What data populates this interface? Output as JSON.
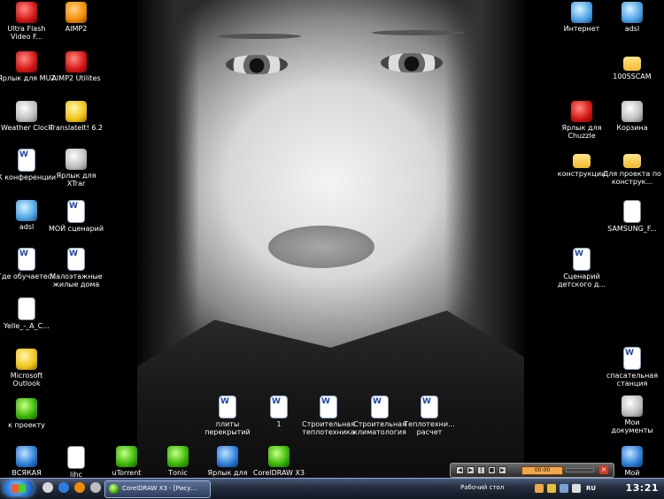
{
  "desktop_icons": [
    {
      "label": "Ultra Flash Video F...",
      "icon": "app-icon"
    },
    {
      "label": "AIMP2",
      "icon": "music-player-icon"
    },
    {
      "label": "Ярлык для MUZ",
      "icon": "shortcut-icon"
    },
    {
      "label": "AIMP2 Utilites",
      "icon": "tools-icon"
    },
    {
      "label": "Weather Clock",
      "icon": "clock-icon"
    },
    {
      "label": "TranslateIt! 6.2",
      "icon": "translate-icon"
    },
    {
      "label": "К конференции",
      "icon": "word-doc-icon"
    },
    {
      "label": "Ярлык для XTrar",
      "icon": "shortcut-icon"
    },
    {
      "label": "adsl",
      "icon": "network-icon"
    },
    {
      "label": "МОЙ сценарий",
      "icon": "word-doc-icon"
    },
    {
      "label": "Где обучаетесь",
      "icon": "word-doc-icon"
    },
    {
      "label": "Малоэтажные жилые дома",
      "icon": "word-doc-icon"
    },
    {
      "label": "Yelle_-_A_C...",
      "icon": "file-icon"
    },
    {
      "label": "Microsoft Outlook",
      "icon": "outlook-icon"
    },
    {
      "label": "к проекту",
      "icon": "folder-icon"
    },
    {
      "label": "ВСЯКАЯ",
      "icon": "folder-icon"
    },
    {
      "label": "lihc",
      "icon": "file-icon"
    },
    {
      "label": "uTorrent",
      "icon": "utorrent-icon"
    },
    {
      "label": "Тоnic",
      "icon": "app-icon"
    },
    {
      "label": "Ярлык для",
      "icon": "shortcut-icon"
    },
    {
      "label": "CorelDRAW X3",
      "icon": "coreldraw-icon"
    },
    {
      "label": "плиты перекрытий",
      "icon": "word-doc-icon"
    },
    {
      "label": "1",
      "icon": "word-doc-icon"
    },
    {
      "label": "Строительная теплотехника",
      "icon": "word-doc-icon"
    },
    {
      "label": "Строительная климатология",
      "icon": "word-doc-icon"
    },
    {
      "label": "Теплотехни... расчет",
      "icon": "word-doc-icon"
    },
    {
      "label": "Интернет",
      "icon": "internet-explorer-icon"
    },
    {
      "label": "adsl",
      "icon": "network-icon"
    },
    {
      "label": "100SSCAM",
      "icon": "folder-icon"
    },
    {
      "label": "Ярлык для Chuzzle",
      "icon": "shortcut-icon"
    },
    {
      "label": "Корзина",
      "icon": "recycle-bin-icon"
    },
    {
      "label": "конструкции",
      "icon": "folder-icon"
    },
    {
      "label": "Для проекта по конструк...",
      "icon": "folder-icon"
    },
    {
      "label": "SAMSUNG_F...",
      "icon": "file-icon"
    },
    {
      "label": "Сценарий детского д...",
      "icon": "word-doc-icon"
    },
    {
      "label": "спасательная станция",
      "icon": "word-doc-icon"
    },
    {
      "label": "Мои документы",
      "icon": "my-documents-icon"
    },
    {
      "label": "Мой",
      "icon": "my-computer-icon"
    }
  ],
  "media_player": {
    "time_display": "00:00",
    "buttons": [
      "prev",
      "play",
      "pause",
      "stop",
      "next"
    ]
  },
  "taskbar": {
    "active_window": "CorelDRAW X3 - [Рису...",
    "toolbar_label": "Рабочий стол",
    "tray_text": "RU",
    "clock": "13:21"
  },
  "colors": {
    "taskbar": "#1b2232",
    "desktop": "#000000",
    "accent": "#2a7de0"
  }
}
